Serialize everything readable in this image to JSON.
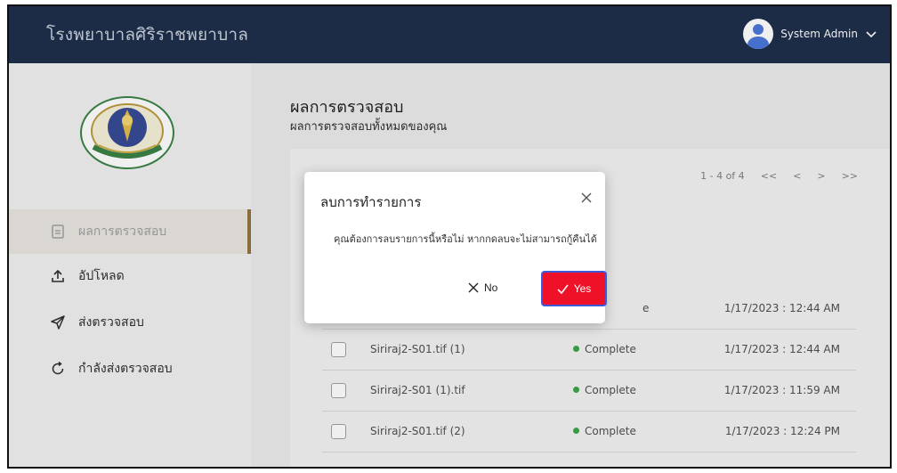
{
  "header": {
    "brand": "โรงพยาบาลศิริราชพยาบาล",
    "user_name": "System Admin"
  },
  "sidebar": {
    "items": [
      {
        "label": "ผลการตรวจสอบ",
        "icon": "document-icon",
        "active": true
      },
      {
        "label": "อัปโหลด",
        "icon": "upload-icon",
        "active": false
      },
      {
        "label": "ส่งตรวจสอบ",
        "icon": "send-icon",
        "active": false
      },
      {
        "label": "กำลังส่งตรวจสอบ",
        "icon": "refresh-icon",
        "active": false
      }
    ]
  },
  "main": {
    "title": "ผลการตรวจสอบ",
    "subtitle": "ผลการตรวจสอบทั้งหมดของคุณ",
    "pagination": {
      "range": "1 - 4 of 4",
      "first": "<<",
      "prev": "<",
      "next": ">",
      "last": ">>"
    },
    "rows": [
      {
        "name": "",
        "status": "e",
        "date": "1/17/2023 : 12:44 AM"
      },
      {
        "name": "Siriraj2-S01.tif (1)",
        "status": "Complete",
        "date": "1/17/2023 : 12:44 AM"
      },
      {
        "name": "Siriraj2-S01 (1).tif",
        "status": "Complete",
        "date": "1/17/2023 : 11:59 AM"
      },
      {
        "name": "Siriraj2-S01.tif (2)",
        "status": "Complete",
        "date": "1/17/2023 : 12:24 PM"
      }
    ]
  },
  "modal": {
    "title": "ลบการทำรายการ",
    "message": "คุณต้องการลบรายการนี้หรือไม่ หากกดลบจะไม่สามารถกู้คืนได้",
    "no_label": "No",
    "yes_label": "Yes"
  },
  "colors": {
    "header_bg": "#0f2240",
    "accent_gold": "#8a6b33",
    "danger": "#ee1127",
    "status_green": "#2f9e3f"
  }
}
